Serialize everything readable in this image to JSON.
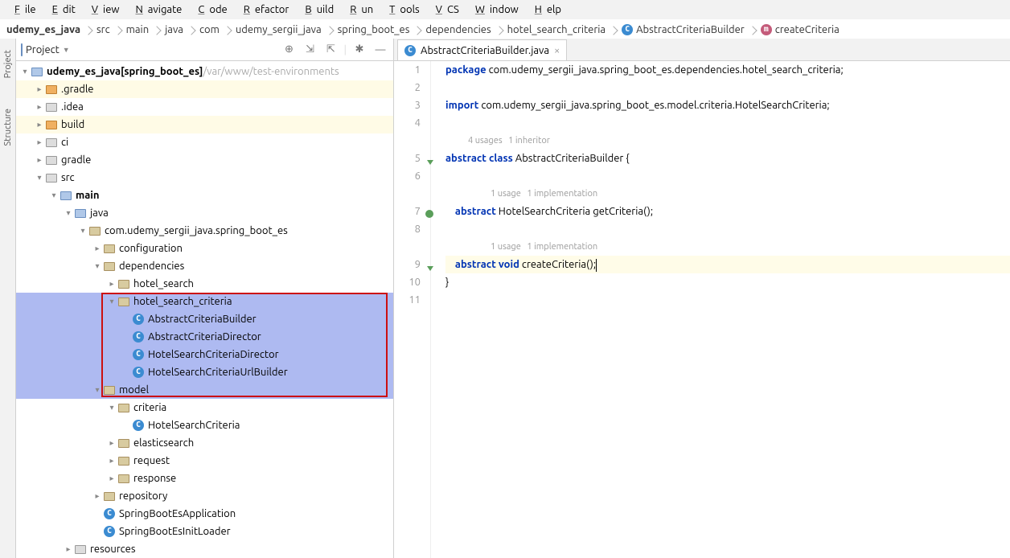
{
  "menu": [
    "File",
    "Edit",
    "View",
    "Navigate",
    "Code",
    "Refactor",
    "Build",
    "Run",
    "Tools",
    "VCS",
    "Window",
    "Help"
  ],
  "breadcrumbs": [
    {
      "label": "udemy_es_java",
      "bold": true
    },
    {
      "label": "src"
    },
    {
      "label": "main"
    },
    {
      "label": "java"
    },
    {
      "label": "com"
    },
    {
      "label": "udemy_sergii_java"
    },
    {
      "label": "spring_boot_es"
    },
    {
      "label": "dependencies"
    },
    {
      "label": "hotel_search_criteria"
    },
    {
      "label": "AbstractCriteriaBuilder",
      "icon": "class"
    },
    {
      "label": "createCriteria",
      "icon": "method"
    }
  ],
  "project_panel": {
    "title": "Project",
    "root": {
      "name": "udemy_es_java",
      "module": "[spring_boot_es]",
      "path": "/var/www/test-environments"
    },
    "items": [
      {
        "indent": 1,
        "arrow": "right",
        "icon": "folder-orange",
        "label": ".gradle",
        "yel": true
      },
      {
        "indent": 1,
        "arrow": "right",
        "icon": "folder",
        "label": ".idea"
      },
      {
        "indent": 1,
        "arrow": "right",
        "icon": "folder-orange",
        "label": "build",
        "yel": true
      },
      {
        "indent": 1,
        "arrow": "right",
        "icon": "folder",
        "label": "ci"
      },
      {
        "indent": 1,
        "arrow": "right",
        "icon": "folder",
        "label": "gradle"
      },
      {
        "indent": 1,
        "arrow": "down",
        "icon": "folder",
        "label": "src"
      },
      {
        "indent": 2,
        "arrow": "down",
        "icon": "folder-blue",
        "label": "main",
        "bold": true
      },
      {
        "indent": 3,
        "arrow": "down",
        "icon": "folder-blue",
        "label": "java"
      },
      {
        "indent": 4,
        "arrow": "down",
        "icon": "pkg",
        "label": "com.udemy_sergii_java.spring_boot_es"
      },
      {
        "indent": 5,
        "arrow": "right",
        "icon": "pkg",
        "label": "configuration"
      },
      {
        "indent": 5,
        "arrow": "down",
        "icon": "pkg",
        "label": "dependencies"
      },
      {
        "indent": 6,
        "arrow": "right",
        "icon": "pkg",
        "label": "hotel_search"
      },
      {
        "indent": 6,
        "arrow": "down",
        "icon": "pkg",
        "label": "hotel_search_criteria",
        "hl": true
      },
      {
        "indent": 7,
        "arrow": "",
        "icon": "class",
        "label": "AbstractCriteriaBuilder",
        "hl": true,
        "sel": true
      },
      {
        "indent": 7,
        "arrow": "",
        "icon": "class",
        "label": "AbstractCriteriaDirector",
        "hl": true
      },
      {
        "indent": 7,
        "arrow": "",
        "icon": "class",
        "label": "HotelSearchCriteriaDirector",
        "hl": true
      },
      {
        "indent": 7,
        "arrow": "",
        "icon": "class",
        "label": "HotelSearchCriteriaUrlBuilder",
        "hl": true
      },
      {
        "indent": 5,
        "arrow": "down",
        "icon": "pkg",
        "label": "model",
        "hl": true
      },
      {
        "indent": 6,
        "arrow": "down",
        "icon": "pkg",
        "label": "criteria"
      },
      {
        "indent": 7,
        "arrow": "",
        "icon": "class",
        "label": "HotelSearchCriteria"
      },
      {
        "indent": 6,
        "arrow": "right",
        "icon": "pkg",
        "label": "elasticsearch"
      },
      {
        "indent": 6,
        "arrow": "right",
        "icon": "pkg",
        "label": "request"
      },
      {
        "indent": 6,
        "arrow": "right",
        "icon": "pkg",
        "label": "response"
      },
      {
        "indent": 5,
        "arrow": "right",
        "icon": "pkg",
        "label": "repository"
      },
      {
        "indent": 5,
        "arrow": "",
        "icon": "class",
        "label": "SpringBootEsApplication"
      },
      {
        "indent": 5,
        "arrow": "",
        "icon": "class",
        "label": "SpringBootEsInitLoader"
      },
      {
        "indent": 3,
        "arrow": "right",
        "icon": "folder",
        "label": "resources"
      }
    ]
  },
  "editor": {
    "tab": "AbstractCriteriaBuilder.java",
    "lines": [
      {
        "n": 1,
        "type": "code",
        "tokens": [
          [
            "kw",
            "package"
          ],
          [
            "pkg",
            " com.udemy_sergii_java.spring_boot_es.dependencies.hotel_search_criteria;"
          ]
        ]
      },
      {
        "n": 2,
        "type": "blank"
      },
      {
        "n": 3,
        "type": "code",
        "tokens": [
          [
            "kw",
            "import"
          ],
          [
            "pkg",
            " com.udemy_sergii_java.spring_boot_es.model.criteria.HotelSearchCriteria;"
          ]
        ]
      },
      {
        "n": 4,
        "type": "blank"
      },
      {
        "type": "hint",
        "text": "4 usages   1 inheritor"
      },
      {
        "n": 5,
        "type": "code",
        "marker": "down",
        "tokens": [
          [
            "kw",
            "abstract class"
          ],
          [
            "cls",
            " AbstractCriteriaBuilder {"
          ]
        ]
      },
      {
        "n": 6,
        "type": "blank"
      },
      {
        "type": "hint",
        "text": "1 usage   1 implementation",
        "indent": 1
      },
      {
        "n": 7,
        "type": "code",
        "marker": "circ",
        "indent": 1,
        "tokens": [
          [
            "kw",
            "abstract"
          ],
          [
            "cls",
            " HotelSearchCriteria getCriteria();"
          ]
        ]
      },
      {
        "n": 8,
        "type": "blank"
      },
      {
        "type": "hint",
        "text": "1 usage   1 implementation",
        "indent": 1
      },
      {
        "n": 9,
        "type": "code",
        "marker": "down",
        "indent": 1,
        "cur": true,
        "tokens": [
          [
            "kw",
            "abstract void"
          ],
          [
            "cls",
            " createCriteria();"
          ]
        ],
        "cursor": true
      },
      {
        "n": 10,
        "type": "code",
        "tokens": [
          [
            "cls",
            "}"
          ]
        ]
      },
      {
        "n": 11,
        "type": "blank"
      }
    ]
  }
}
